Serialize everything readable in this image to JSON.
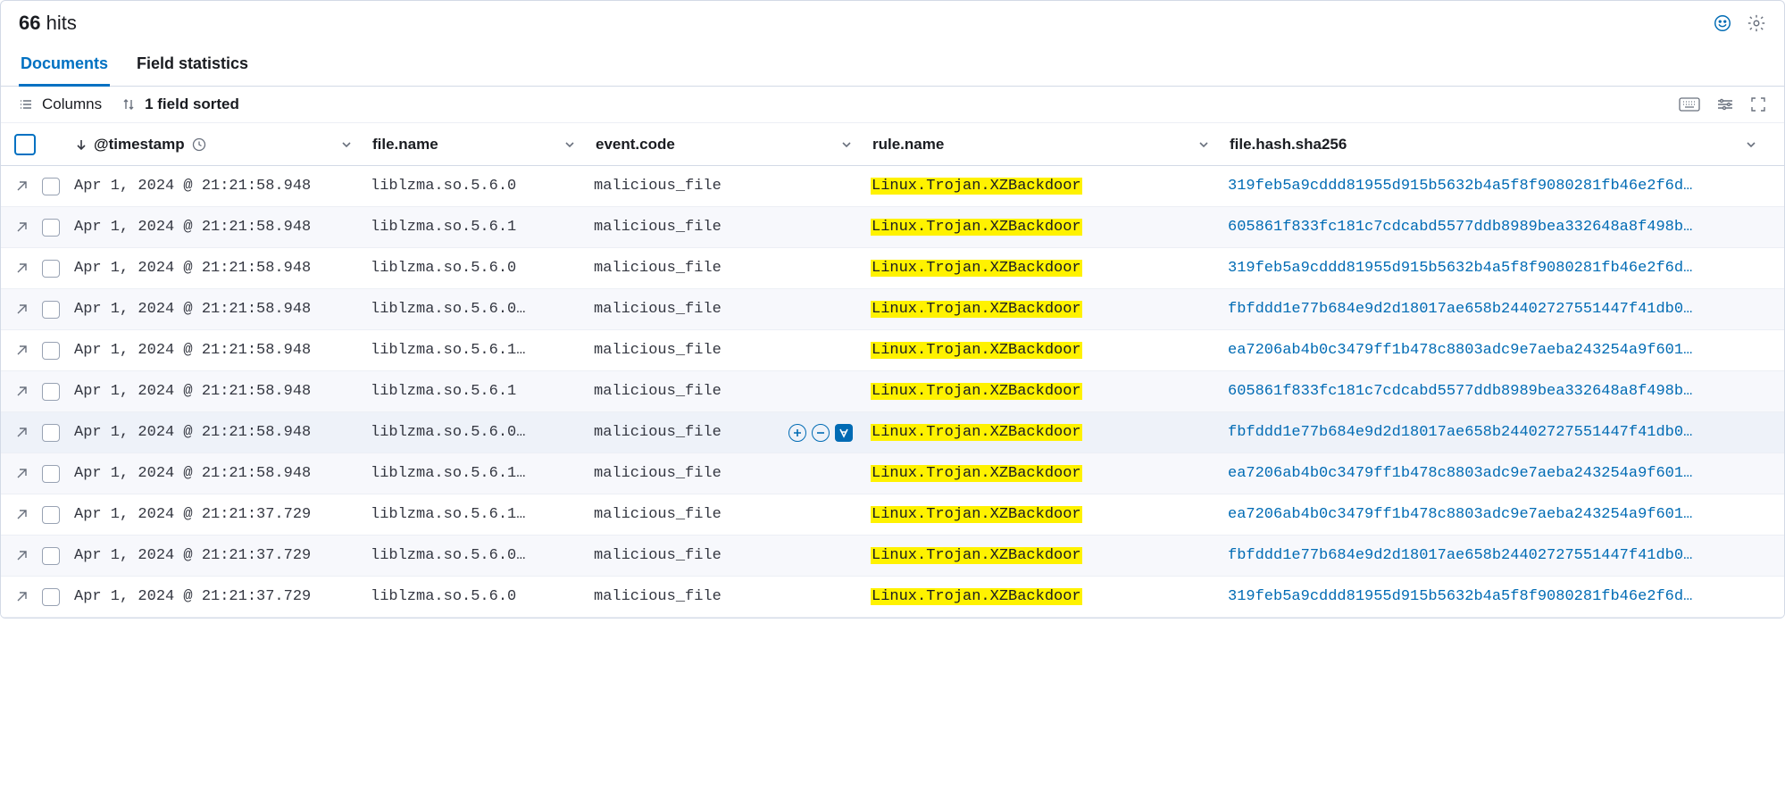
{
  "hits": {
    "count": "66",
    "label": "hits"
  },
  "tabs": {
    "documents": "Documents",
    "fieldstats": "Field statistics"
  },
  "toolbar": {
    "columns": "Columns",
    "sorted": "1 field sorted"
  },
  "columns": {
    "timestamp": "@timestamp",
    "filename": "file.name",
    "eventcode": "event.code",
    "rulename": "rule.name",
    "hash": "file.hash.sha256"
  },
  "rows": [
    {
      "ts": "Apr 1, 2024 @ 21:21:58.948",
      "fname": "liblzma.so.5.6.0",
      "ecode": "malicious_file",
      "rule": "Linux.Trojan.XZBackdoor",
      "hash": "319feb5a9cddd81955d915b5632b4a5f8f9080281fb46e2f6d…"
    },
    {
      "ts": "Apr 1, 2024 @ 21:21:58.948",
      "fname": "liblzma.so.5.6.1",
      "ecode": "malicious_file",
      "rule": "Linux.Trojan.XZBackdoor",
      "hash": "605861f833fc181c7cdcabd5577ddb8989bea332648a8f498b…"
    },
    {
      "ts": "Apr 1, 2024 @ 21:21:58.948",
      "fname": "liblzma.so.5.6.0",
      "ecode": "malicious_file",
      "rule": "Linux.Trojan.XZBackdoor",
      "hash": "319feb5a9cddd81955d915b5632b4a5f8f9080281fb46e2f6d…"
    },
    {
      "ts": "Apr 1, 2024 @ 21:21:58.948",
      "fname": "liblzma.so.5.6.0…",
      "ecode": "malicious_file",
      "rule": "Linux.Trojan.XZBackdoor",
      "hash": "fbfddd1e77b684e9d2d18017ae658b24402727551447f41db0…"
    },
    {
      "ts": "Apr 1, 2024 @ 21:21:58.948",
      "fname": "liblzma.so.5.6.1…",
      "ecode": "malicious_file",
      "rule": "Linux.Trojan.XZBackdoor",
      "hash": "ea7206ab4b0c3479ff1b478c8803adc9e7aeba243254a9f601…"
    },
    {
      "ts": "Apr 1, 2024 @ 21:21:58.948",
      "fname": "liblzma.so.5.6.1",
      "ecode": "malicious_file",
      "rule": "Linux.Trojan.XZBackdoor",
      "hash": "605861f833fc181c7cdcabd5577ddb8989bea332648a8f498b…"
    },
    {
      "ts": "Apr 1, 2024 @ 21:21:58.948",
      "fname": "liblzma.so.5.6.0…",
      "ecode": "malicious_file",
      "rule": "Linux.Trojan.XZBackdoor",
      "hash": "fbfddd1e77b684e9d2d18017ae658b24402727551447f41db0…",
      "hovered": true
    },
    {
      "ts": "Apr 1, 2024 @ 21:21:58.948",
      "fname": "liblzma.so.5.6.1…",
      "ecode": "malicious_file",
      "rule": "Linux.Trojan.XZBackdoor",
      "hash": "ea7206ab4b0c3479ff1b478c8803adc9e7aeba243254a9f601…"
    },
    {
      "ts": "Apr 1, 2024 @ 21:21:37.729",
      "fname": "liblzma.so.5.6.1…",
      "ecode": "malicious_file",
      "rule": "Linux.Trojan.XZBackdoor",
      "hash": "ea7206ab4b0c3479ff1b478c8803adc9e7aeba243254a9f601…"
    },
    {
      "ts": "Apr 1, 2024 @ 21:21:37.729",
      "fname": "liblzma.so.5.6.0…",
      "ecode": "malicious_file",
      "rule": "Linux.Trojan.XZBackdoor",
      "hash": "fbfddd1e77b684e9d2d18017ae658b24402727551447f41db0…"
    },
    {
      "ts": "Apr 1, 2024 @ 21:21:37.729",
      "fname": "liblzma.so.5.6.0",
      "ecode": "malicious_file",
      "rule": "Linux.Trojan.XZBackdoor",
      "hash": "319feb5a9cddd81955d915b5632b4a5f8f9080281fb46e2f6d…"
    }
  ]
}
